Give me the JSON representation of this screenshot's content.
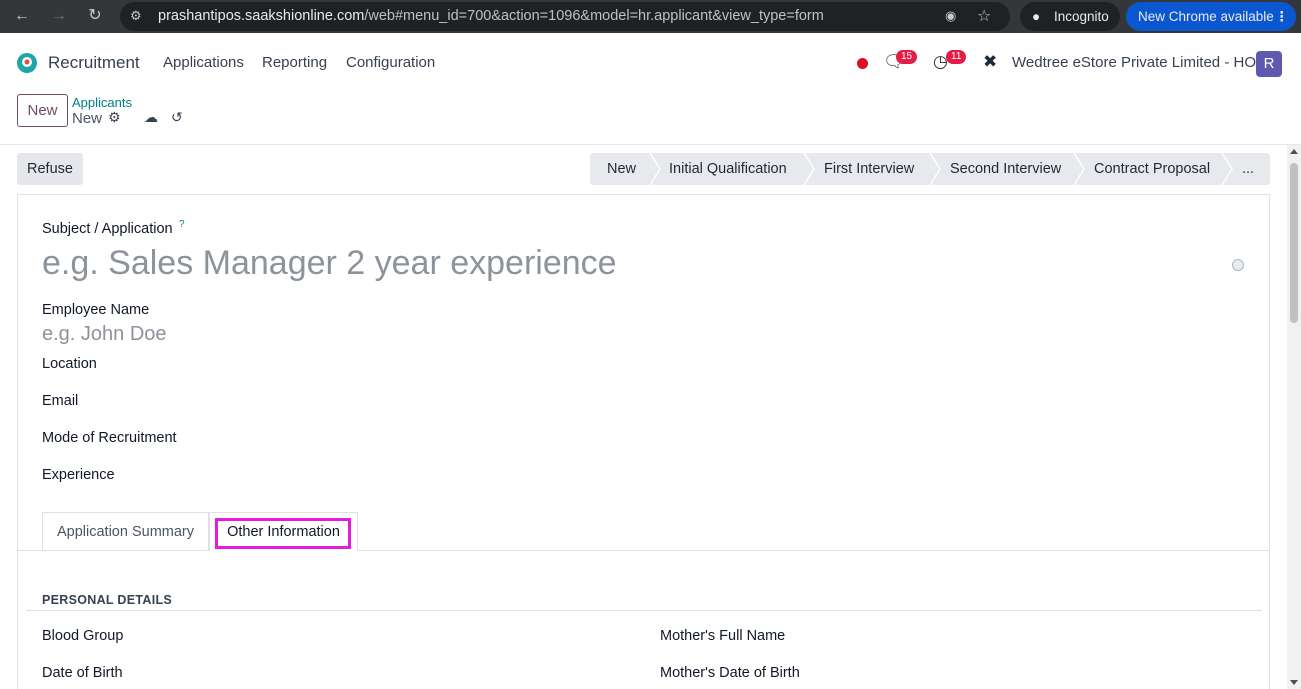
{
  "browser": {
    "url_host": "prashantipos.saakshionline.com",
    "url_path": "/web#menu_id=700&action=1096&model=hr.applicant&view_type=form",
    "incognito_label": "Incognito",
    "update_label": "New Chrome available"
  },
  "navbar": {
    "app_name": "Recruitment",
    "menu": [
      "Applications",
      "Reporting",
      "Configuration"
    ],
    "messages_count": "15",
    "activities_count": "11",
    "company": "Wedtree eStore Private Limited - HO",
    "avatar_letter": "R",
    "colors": {
      "record_dot": "#e00b24",
      "badge": "#e11d48",
      "avatar": "#5f5ab0"
    }
  },
  "control_panel": {
    "new_button": "New",
    "breadcrumb_parent": "Applicants",
    "breadcrumb_current": "New"
  },
  "status": {
    "refuse_button": "Refuse",
    "stages": [
      "New",
      "Initial Qualification",
      "First Interview",
      "Second Interview",
      "Contract Proposal",
      "..."
    ],
    "active_stage": "New"
  },
  "form": {
    "subject_label": "Subject / Application",
    "subject_help": "?",
    "subject_placeholder": "e.g. Sales Manager 2 year experience",
    "employee_name_label": "Employee Name",
    "employee_name_placeholder": "e.g. John Doe",
    "location_label": "Location",
    "email_label": "Email",
    "mode_label": "Mode of Recruitment",
    "experience_label": "Experience"
  },
  "tabs": {
    "items": [
      "Application Summary",
      "Other Information"
    ],
    "active": "Other Information",
    "highlight_color": "#e21de0"
  },
  "personal": {
    "section_title": "PERSONAL DETAILS",
    "left": [
      "Blood Group",
      "Date of Birth"
    ],
    "right": [
      "Mother's Full Name",
      "Mother's Date of Birth"
    ]
  }
}
